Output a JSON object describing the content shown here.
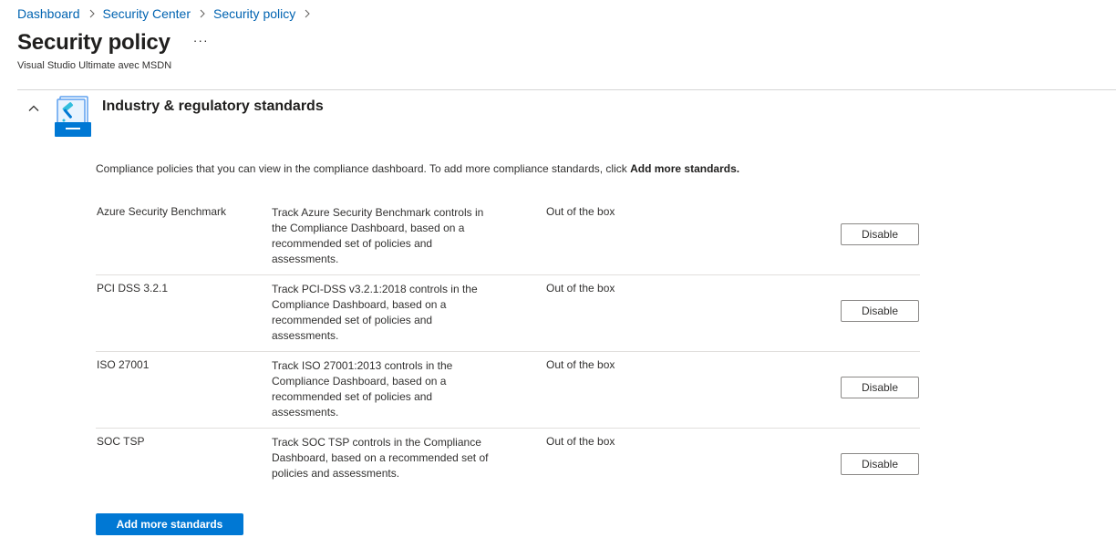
{
  "breadcrumb": {
    "items": [
      "Dashboard",
      "Security Center",
      "Security policy"
    ]
  },
  "header": {
    "title": "Security policy",
    "more": "···",
    "subtitle": "Visual Studio Ultimate avec MSDN"
  },
  "section": {
    "title": "Industry & regulatory standards",
    "expanded": true,
    "description_prefix": "Compliance policies that you can view in the compliance dashboard. To add more compliance standards, click ",
    "description_link": "Add more standards."
  },
  "standards": [
    {
      "name": "Azure Security Benchmark",
      "description": "Track Azure Security Benchmark controls in the Compliance Dashboard, based on a recommended set of policies and assessments.",
      "type": "Out of the box",
      "action": "Disable"
    },
    {
      "name": "PCI DSS 3.2.1",
      "description": "Track PCI-DSS v3.2.1:2018 controls in the Compliance Dashboard, based on a recommended set of policies and assessments.",
      "type": "Out of the box",
      "action": "Disable"
    },
    {
      "name": "ISO 27001",
      "description": "Track ISO 27001:2013 controls in the Compliance Dashboard, based on a recommended set of policies and assessments.",
      "type": "Out of the box",
      "action": "Disable"
    },
    {
      "name": "SOC TSP",
      "description": "Track SOC TSP controls in the Compliance Dashboard, based on a recommended set of policies and assessments.",
      "type": "Out of the box",
      "action": "Disable"
    }
  ],
  "actions": {
    "add_more": "Add more standards"
  },
  "colors": {
    "link": "#0063b1",
    "primary": "#0078d4",
    "text": "#323130",
    "divider": "#e1dfdd"
  }
}
